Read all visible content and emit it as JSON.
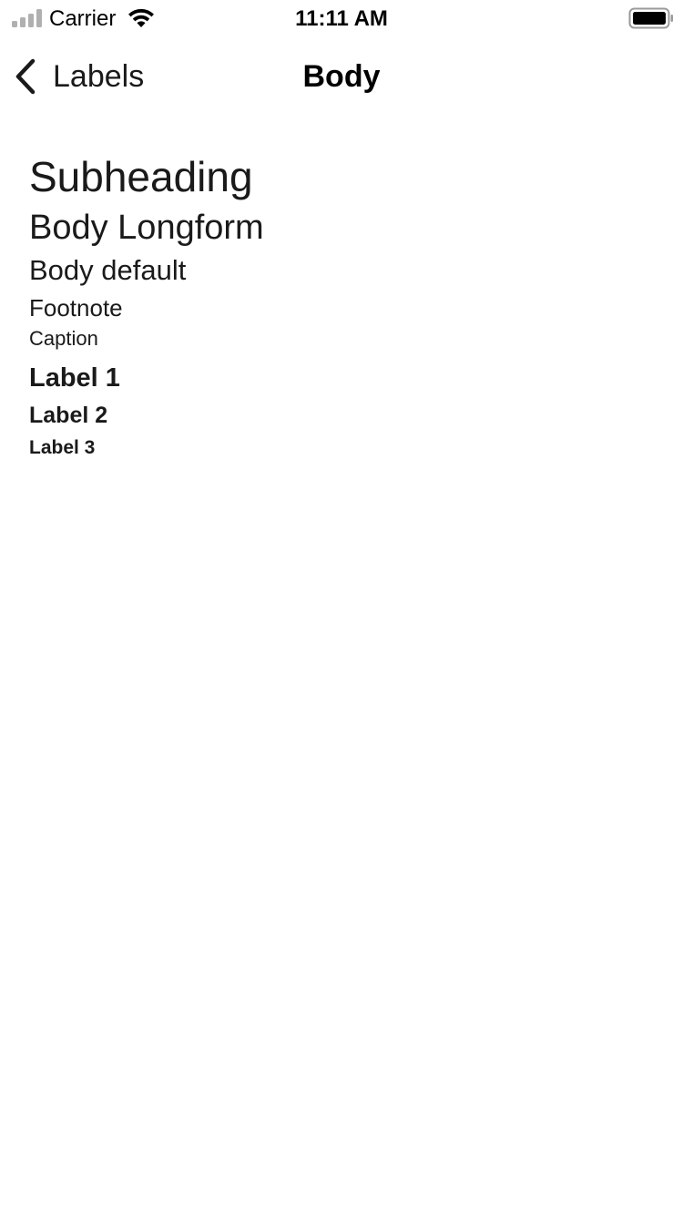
{
  "status_bar": {
    "carrier": "Carrier",
    "time": "11:11 AM"
  },
  "nav": {
    "back_label": "Labels",
    "title": "Body"
  },
  "samples": {
    "subheading": "Subheading",
    "body_longform": "Body Longform",
    "body_default": "Body default",
    "footnote": "Footnote",
    "caption": "Caption",
    "label_1": "Label 1",
    "label_2": "Label 2",
    "label_3": "Label 3"
  },
  "icons": {
    "signal": "cellular-signal-icon",
    "wifi": "wifi-icon",
    "battery": "battery-icon",
    "back": "chevron-left-icon"
  },
  "colors": {
    "background": "#ffffff",
    "text": "#1a1a1a"
  }
}
